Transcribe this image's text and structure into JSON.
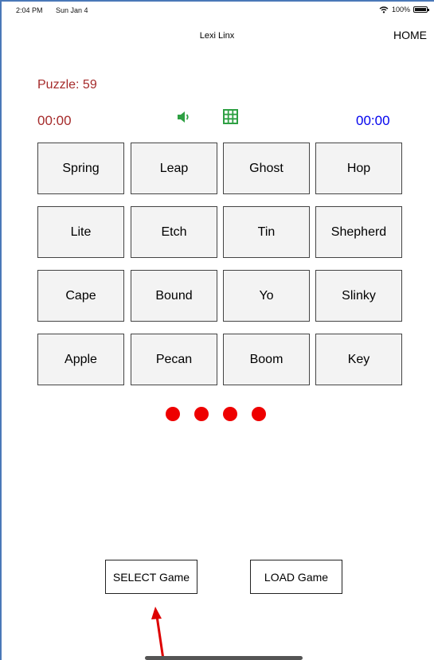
{
  "status_bar": {
    "time": "2:04 PM",
    "date": "Sun Jan 4",
    "battery": "100%"
  },
  "nav": {
    "title": "Lexi Linx",
    "home_label": "HOME"
  },
  "game": {
    "puzzle_label": "Puzzle: 59",
    "timer_left": "00:00",
    "timer_right": "00:00",
    "tiles": [
      [
        "Spring",
        "Leap",
        "Ghost",
        "Hop"
      ],
      [
        "Lite",
        "Etch",
        "Tin",
        "Shepherd"
      ],
      [
        "Cape",
        "Bound",
        "Yo",
        "Slinky"
      ],
      [
        "Apple",
        "Pecan",
        "Boom",
        "Key"
      ]
    ],
    "remaining_mistakes": 4
  },
  "buttons": {
    "select_game": "SELECT Game",
    "load_game": "LOAD Game"
  },
  "colors": {
    "puzzle_text": "#a52a2a",
    "timer_right": "#0000ee",
    "icon_green": "#2ea043",
    "dot_red": "#ee0000",
    "arrow_red": "#dd0000",
    "frame_border": "#4a78b8"
  },
  "icons": [
    "wifi-icon",
    "battery-icon",
    "speaker-icon",
    "grid-icon"
  ]
}
